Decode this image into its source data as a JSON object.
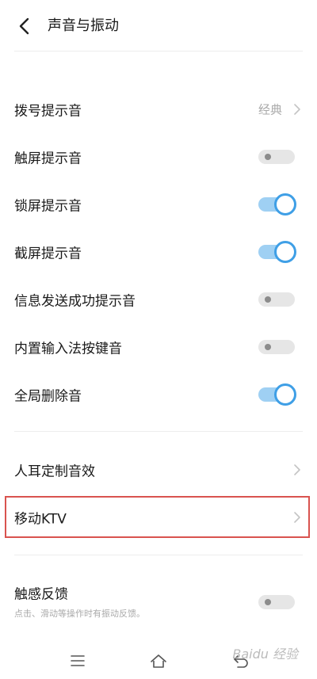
{
  "header": {
    "title": "声音与振动"
  },
  "rows": [
    {
      "label": "拨号提示音",
      "value": "经典"
    },
    {
      "label": "触屏提示音",
      "toggle": false
    },
    {
      "label": "锁屏提示音",
      "toggle": true
    },
    {
      "label": "截屏提示音",
      "toggle": true
    },
    {
      "label": "信息发送成功提示音",
      "toggle": false
    },
    {
      "label": "内置输入法按键音",
      "toggle": false
    },
    {
      "label": "全局删除音",
      "toggle": true
    },
    {
      "label": "人耳定制音效"
    },
    {
      "label": "移动KTV"
    },
    {
      "label": "触感反馈",
      "sublabel": "点击、滑动等操作时有振动反馈。",
      "toggle": false
    }
  ],
  "watermark": "Baidu 经验",
  "colors": {
    "toggle_on": "#3f9fe6",
    "highlight": "#d9534f"
  }
}
